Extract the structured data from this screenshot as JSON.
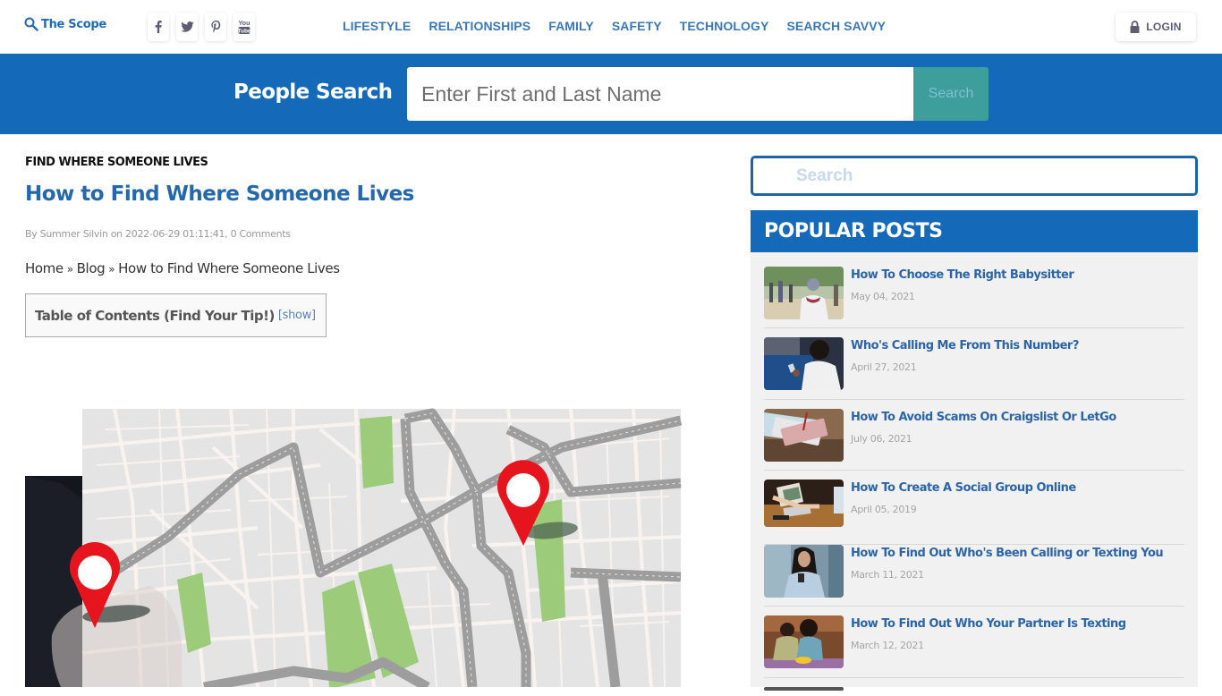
{
  "header": {
    "logo_text": "The Scope",
    "social": [
      {
        "name": "facebook",
        "icon": "facebook-icon",
        "glyph": "f"
      },
      {
        "name": "twitter",
        "icon": "twitter-icon"
      },
      {
        "name": "pinterest",
        "icon": "pinterest-icon",
        "glyph": "P"
      },
      {
        "name": "youtube",
        "icon": "youtube-icon"
      }
    ],
    "nav": [
      "LIFESTYLE",
      "RELATIONSHIPS",
      "FAMILY",
      "SAFETY",
      "TECHNOLOGY",
      "SEARCH SAVVY"
    ],
    "login_label": "LOGIN"
  },
  "people_search": {
    "title": "People Search",
    "input_placeholder": "Enter First and Last Name",
    "input_value": "",
    "button_label": "Search"
  },
  "article": {
    "category": "FIND WHERE SOMEONE LIVES",
    "title": "How to Find Where Someone Lives",
    "meta": "By Summer Silvin on 2022-06-29 01:11:41, 0 Comments",
    "breadcrumb": [
      "Home",
      "Blog",
      "How to Find Where Someone Lives"
    ],
    "breadcrumb_sep": "»",
    "toc_title": "Table of Contents (Find Your Tip!)",
    "toc_toggle": "[show]",
    "hero_alt": "Hand pointing at a city map with red location pins"
  },
  "sidebar": {
    "search_placeholder": "Search",
    "search_value": "",
    "popular_title": "POPULAR POSTS",
    "posts": [
      {
        "title": "How To Choose The Right Babysitter",
        "date": "May 04, 2021"
      },
      {
        "title": "Who's Calling Me From This Number?",
        "date": "April 27, 2021"
      },
      {
        "title": "How To Avoid Scams On Craigslist Or LetGo",
        "date": "July 06, 2021"
      },
      {
        "title": "How To Create A Social Group Online",
        "date": "April 05, 2019"
      },
      {
        "title": "How To Find Out Who's Been Calling or Texting You",
        "date": "March 11, 2021"
      },
      {
        "title": "How To Find Out Who Your Partner Is Texting",
        "date": "March 12, 2021"
      }
    ]
  },
  "colors": {
    "brand_blue": "#1469b8",
    "link_blue": "#2367ad",
    "search_button": "#3e9e9c",
    "sidebar_bg": "#f1f1f1"
  }
}
